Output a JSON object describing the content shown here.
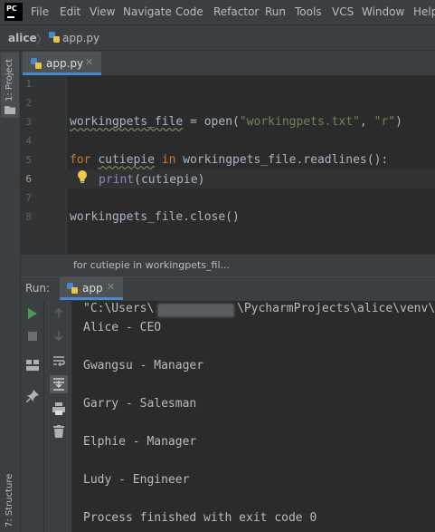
{
  "app": {
    "logo_text": "PC"
  },
  "menu": [
    "File",
    "Edit",
    "View",
    "Navigate",
    "Code",
    "Refactor",
    "Run",
    "Tools",
    "VCS",
    "Window",
    "Help"
  ],
  "navbar": {
    "project": "alice",
    "file": "app.py"
  },
  "left_strip": {
    "project_tab": "1: Project",
    "structure_tab": "7: Structure"
  },
  "editor": {
    "tab_label": "app.py",
    "line_numbers": [
      "1",
      "2",
      "3",
      "4",
      "5",
      "6",
      "7",
      "8"
    ],
    "lines": {
      "l3_var": "workingpets_file",
      "l3_eq": " = ",
      "l3_fn": "open(",
      "l3_str1": "\"workingpets.txt\"",
      "l3_comma": ", ",
      "l3_str2": "\"r\"",
      "l3_close": ")",
      "l5_for": "for",
      "l5_var": "cutiepie",
      "l5_in": "in",
      "l5_rest": "workingpets_file.readlines():",
      "l6_print": "print",
      "l6_arg": "(cutiepie)",
      "l8_code": "workingpets_file.close()"
    }
  },
  "breadcrumb": "for cutiepie in workingpets_fil...",
  "run": {
    "label": "Run:",
    "tab_label": "app",
    "console": {
      "cmd_prefix": "\"C:\\Users\\",
      "cmd_suffix": "\\PycharmProjects\\alice\\venv\\",
      "lines": [
        "Alice - CEO",
        "Gwangsu - Manager",
        "Garry - Salesman",
        "Elphie - Manager",
        "Ludy - Engineer"
      ],
      "finish": "Process finished with exit code 0"
    }
  },
  "colors": {
    "accent": "#4a88c7",
    "background": "#2b2b2b",
    "keyword": "#cc7832",
    "string": "#6a8759",
    "run_green": "#499c54"
  }
}
